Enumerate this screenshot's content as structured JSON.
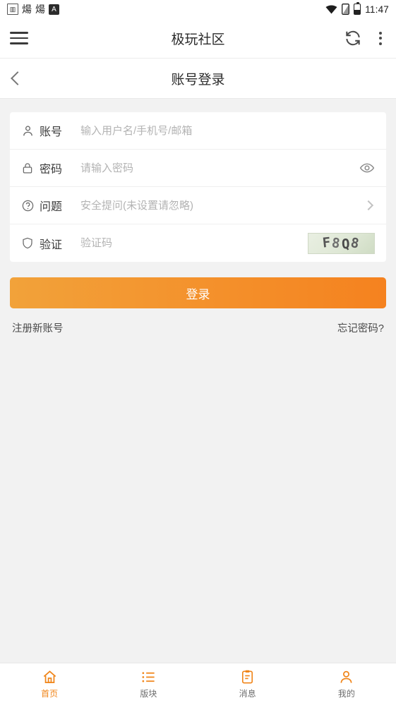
{
  "status_bar": {
    "left_icons": [
      "photo-icon",
      "flame-icon",
      "flame-icon",
      "a-badge-icon"
    ],
    "right_icons": [
      "wifi-icon",
      "sim-icon",
      "battery-icon"
    ],
    "time": "11:47"
  },
  "app_bar": {
    "menu_icon": "hamburger-icon",
    "title": "极玩社区",
    "refresh_icon": "refresh-icon",
    "overflow_icon": "more-vertical-icon"
  },
  "sub_header": {
    "back_icon": "back-chevron-icon",
    "title": "账号登录"
  },
  "form": {
    "fields": [
      {
        "icon": "user-icon",
        "label": "账号",
        "placeholder": "输入用户名/手机号/邮箱",
        "value": "",
        "name": "account"
      },
      {
        "icon": "lock-icon",
        "label": "密码",
        "placeholder": "请输入密码",
        "value": "",
        "name": "password",
        "trailing_icon": "eye-icon"
      },
      {
        "icon": "question-icon",
        "label": "问题",
        "placeholder": "安全提问(未设置请忽略)",
        "value": "",
        "name": "security-question",
        "trailing_icon": "chevron-right-icon"
      },
      {
        "icon": "shield-icon",
        "label": "验证",
        "placeholder": "验证码",
        "value": "",
        "name": "captcha",
        "trailing_icon": "captcha-image"
      }
    ],
    "captcha_text": "F8Q8",
    "submit_label": "登录",
    "register_label": "注册新账号",
    "forgot_label": "忘记密码?"
  },
  "bottom_nav": {
    "items": [
      {
        "icon": "home-icon",
        "label": "首页",
        "active": true
      },
      {
        "icon": "list-icon",
        "label": "版块",
        "active": false
      },
      {
        "icon": "message-icon",
        "label": "消息",
        "active": false
      },
      {
        "icon": "person-icon",
        "label": "我的",
        "active": false
      }
    ]
  },
  "colors": {
    "accent": "#f08519",
    "button_gradient_start": "#f2a23a",
    "button_gradient_end": "#f5821f",
    "page_bg": "#f2f2f2",
    "card_bg": "#ffffff"
  }
}
